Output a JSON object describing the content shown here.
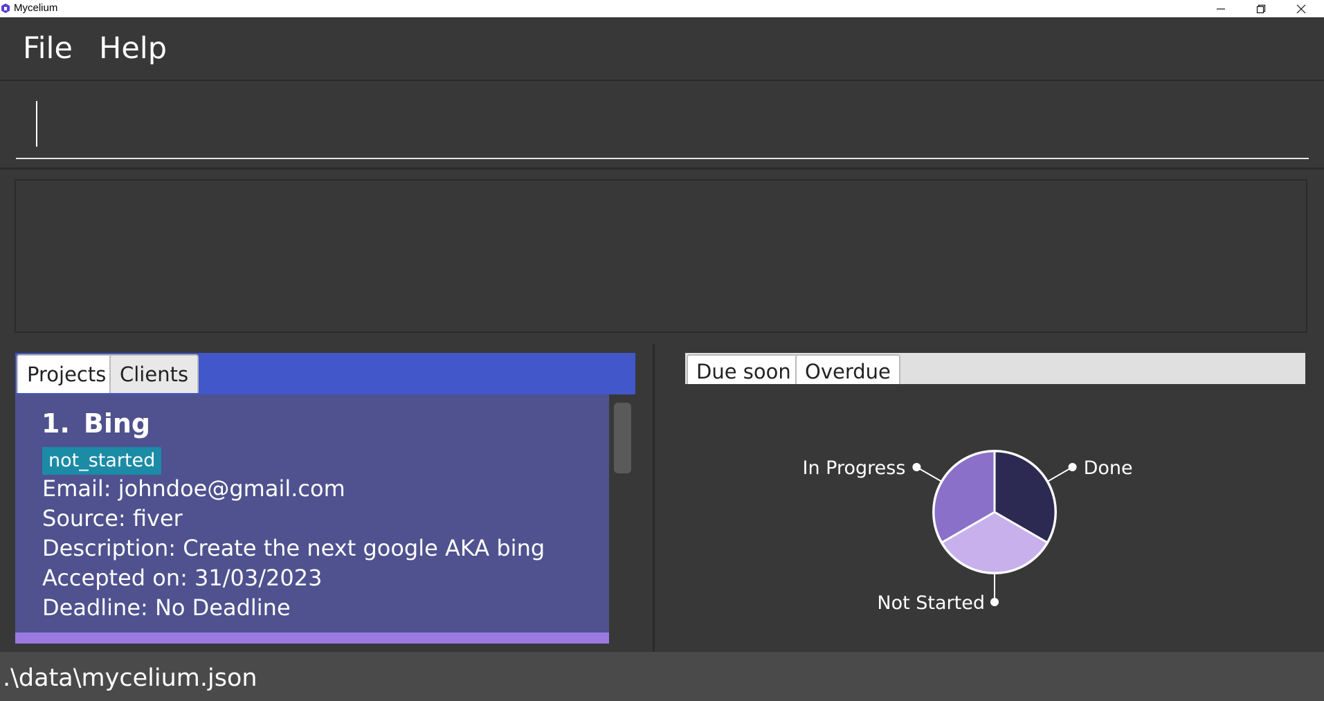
{
  "window": {
    "title": "Mycelium",
    "controls": [
      "minimize",
      "restore",
      "close"
    ]
  },
  "menu": {
    "items": [
      "File",
      "Help"
    ]
  },
  "command": {
    "value": "",
    "placeholder": ""
  },
  "result": {
    "text": ""
  },
  "left_tabs": {
    "tabs": [
      "Projects",
      "Clients"
    ],
    "selected": "Projects"
  },
  "projects": [
    {
      "index": "1.",
      "name": "Bing",
      "status": "not_started",
      "email": "Email: johndoe@gmail.com",
      "source": "Source: fiver",
      "description": "Description: Create the next google AKA bing",
      "accepted": "Accepted on: 31/03/2023",
      "deadline": "Deadline: No Deadline"
    }
  ],
  "right_tabs": {
    "tabs": [
      "Due soon",
      "Overdue"
    ]
  },
  "chart_data": {
    "type": "pie",
    "categories": [
      "Done",
      "Not Started",
      "In Progress"
    ],
    "values": [
      1,
      1,
      1
    ],
    "colors": [
      "#2c2a52",
      "#c7b0ec",
      "#8a70c9"
    ],
    "title": ""
  },
  "status_bar": {
    "path": ".\\data\\mycelium.json"
  }
}
